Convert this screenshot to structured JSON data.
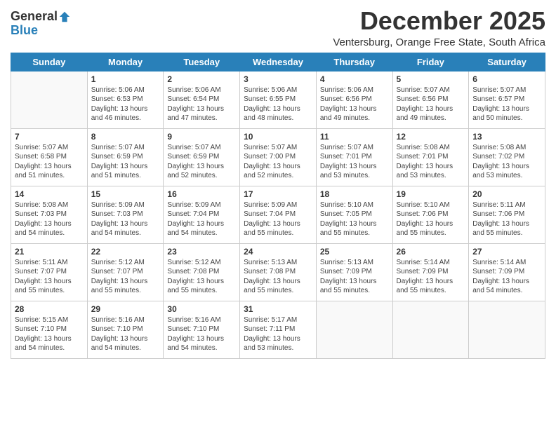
{
  "logo": {
    "general": "General",
    "blue": "Blue"
  },
  "header": {
    "month": "December 2025",
    "location": "Ventersburg, Orange Free State, South Africa"
  },
  "days": [
    "Sunday",
    "Monday",
    "Tuesday",
    "Wednesday",
    "Thursday",
    "Friday",
    "Saturday"
  ],
  "weeks": [
    [
      {
        "day": "",
        "content": ""
      },
      {
        "day": "1",
        "content": "Sunrise: 5:06 AM\nSunset: 6:53 PM\nDaylight: 13 hours\nand 46 minutes."
      },
      {
        "day": "2",
        "content": "Sunrise: 5:06 AM\nSunset: 6:54 PM\nDaylight: 13 hours\nand 47 minutes."
      },
      {
        "day": "3",
        "content": "Sunrise: 5:06 AM\nSunset: 6:55 PM\nDaylight: 13 hours\nand 48 minutes."
      },
      {
        "day": "4",
        "content": "Sunrise: 5:06 AM\nSunset: 6:56 PM\nDaylight: 13 hours\nand 49 minutes."
      },
      {
        "day": "5",
        "content": "Sunrise: 5:07 AM\nSunset: 6:56 PM\nDaylight: 13 hours\nand 49 minutes."
      },
      {
        "day": "6",
        "content": "Sunrise: 5:07 AM\nSunset: 6:57 PM\nDaylight: 13 hours\nand 50 minutes."
      }
    ],
    [
      {
        "day": "7",
        "content": "Sunrise: 5:07 AM\nSunset: 6:58 PM\nDaylight: 13 hours\nand 51 minutes."
      },
      {
        "day": "8",
        "content": "Sunrise: 5:07 AM\nSunset: 6:59 PM\nDaylight: 13 hours\nand 51 minutes."
      },
      {
        "day": "9",
        "content": "Sunrise: 5:07 AM\nSunset: 6:59 PM\nDaylight: 13 hours\nand 52 minutes."
      },
      {
        "day": "10",
        "content": "Sunrise: 5:07 AM\nSunset: 7:00 PM\nDaylight: 13 hours\nand 52 minutes."
      },
      {
        "day": "11",
        "content": "Sunrise: 5:07 AM\nSunset: 7:01 PM\nDaylight: 13 hours\nand 53 minutes."
      },
      {
        "day": "12",
        "content": "Sunrise: 5:08 AM\nSunset: 7:01 PM\nDaylight: 13 hours\nand 53 minutes."
      },
      {
        "day": "13",
        "content": "Sunrise: 5:08 AM\nSunset: 7:02 PM\nDaylight: 13 hours\nand 53 minutes."
      }
    ],
    [
      {
        "day": "14",
        "content": "Sunrise: 5:08 AM\nSunset: 7:03 PM\nDaylight: 13 hours\nand 54 minutes."
      },
      {
        "day": "15",
        "content": "Sunrise: 5:09 AM\nSunset: 7:03 PM\nDaylight: 13 hours\nand 54 minutes."
      },
      {
        "day": "16",
        "content": "Sunrise: 5:09 AM\nSunset: 7:04 PM\nDaylight: 13 hours\nand 54 minutes."
      },
      {
        "day": "17",
        "content": "Sunrise: 5:09 AM\nSunset: 7:04 PM\nDaylight: 13 hours\nand 55 minutes."
      },
      {
        "day": "18",
        "content": "Sunrise: 5:10 AM\nSunset: 7:05 PM\nDaylight: 13 hours\nand 55 minutes."
      },
      {
        "day": "19",
        "content": "Sunrise: 5:10 AM\nSunset: 7:06 PM\nDaylight: 13 hours\nand 55 minutes."
      },
      {
        "day": "20",
        "content": "Sunrise: 5:11 AM\nSunset: 7:06 PM\nDaylight: 13 hours\nand 55 minutes."
      }
    ],
    [
      {
        "day": "21",
        "content": "Sunrise: 5:11 AM\nSunset: 7:07 PM\nDaylight: 13 hours\nand 55 minutes."
      },
      {
        "day": "22",
        "content": "Sunrise: 5:12 AM\nSunset: 7:07 PM\nDaylight: 13 hours\nand 55 minutes."
      },
      {
        "day": "23",
        "content": "Sunrise: 5:12 AM\nSunset: 7:08 PM\nDaylight: 13 hours\nand 55 minutes."
      },
      {
        "day": "24",
        "content": "Sunrise: 5:13 AM\nSunset: 7:08 PM\nDaylight: 13 hours\nand 55 minutes."
      },
      {
        "day": "25",
        "content": "Sunrise: 5:13 AM\nSunset: 7:09 PM\nDaylight: 13 hours\nand 55 minutes."
      },
      {
        "day": "26",
        "content": "Sunrise: 5:14 AM\nSunset: 7:09 PM\nDaylight: 13 hours\nand 55 minutes."
      },
      {
        "day": "27",
        "content": "Sunrise: 5:14 AM\nSunset: 7:09 PM\nDaylight: 13 hours\nand 54 minutes."
      }
    ],
    [
      {
        "day": "28",
        "content": "Sunrise: 5:15 AM\nSunset: 7:10 PM\nDaylight: 13 hours\nand 54 minutes."
      },
      {
        "day": "29",
        "content": "Sunrise: 5:16 AM\nSunset: 7:10 PM\nDaylight: 13 hours\nand 54 minutes."
      },
      {
        "day": "30",
        "content": "Sunrise: 5:16 AM\nSunset: 7:10 PM\nDaylight: 13 hours\nand 54 minutes."
      },
      {
        "day": "31",
        "content": "Sunrise: 5:17 AM\nSunset: 7:11 PM\nDaylight: 13 hours\nand 53 minutes."
      },
      {
        "day": "",
        "content": ""
      },
      {
        "day": "",
        "content": ""
      },
      {
        "day": "",
        "content": ""
      }
    ]
  ]
}
